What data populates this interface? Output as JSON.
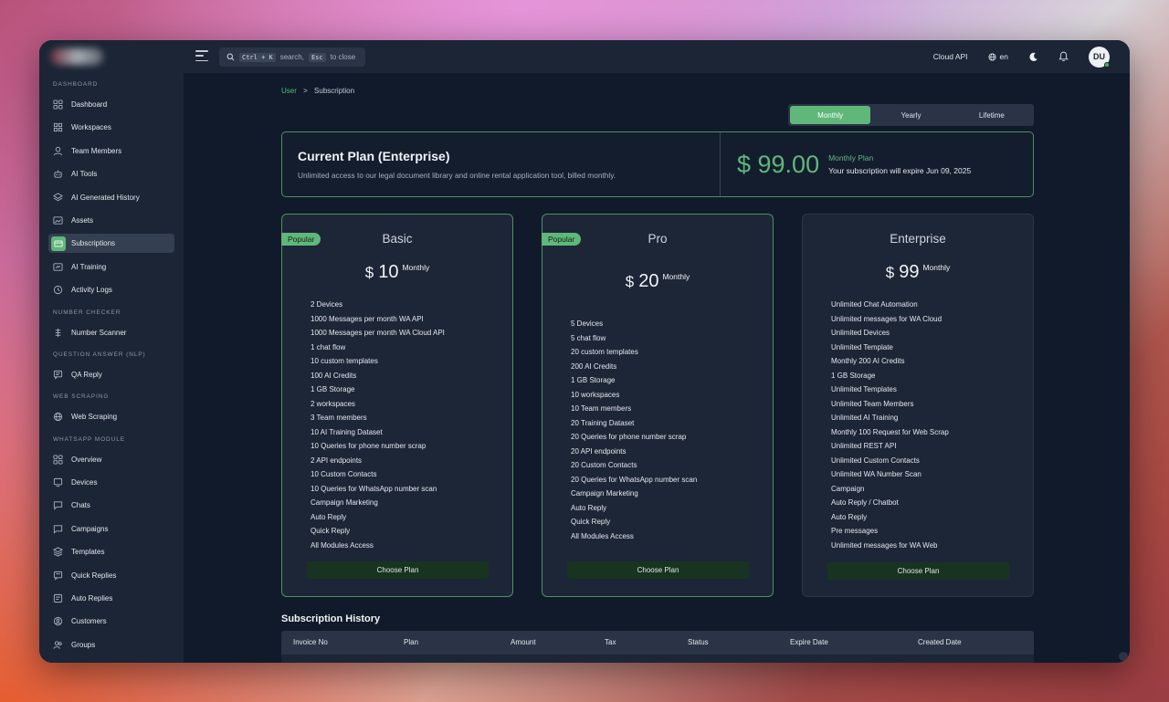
{
  "topbar": {
    "search": {
      "key1": "Ctrl + K",
      "text1": "search,",
      "key2": "Esc",
      "text2": "to close"
    },
    "cloud_api": "Cloud API",
    "language": "en",
    "avatar_initials": "DU"
  },
  "sidebar": {
    "sections": [
      {
        "title": "DASHBOARD",
        "items": [
          {
            "label": "Dashboard",
            "icon": "grid-icon"
          },
          {
            "label": "Workspaces",
            "icon": "workspace-icon"
          },
          {
            "label": "Team Members",
            "icon": "user-icon"
          },
          {
            "label": "AI Tools",
            "icon": "robot-icon"
          },
          {
            "label": "AI Generated History",
            "icon": "stack-icon"
          },
          {
            "label": "Assets",
            "icon": "image-icon"
          },
          {
            "label": "Subscriptions",
            "icon": "card-icon",
            "active": true
          },
          {
            "label": "AI Training",
            "icon": "training-icon"
          },
          {
            "label": "Activity Logs",
            "icon": "history-icon"
          }
        ]
      },
      {
        "title": "NUMBER CHECKER",
        "items": [
          {
            "label": "Number Scanner",
            "icon": "scanner-icon"
          }
        ]
      },
      {
        "title": "QUESTION ANSWER (NLP)",
        "items": [
          {
            "label": "QA Reply",
            "icon": "message-icon"
          }
        ]
      },
      {
        "title": "WEB SCRAPING",
        "items": [
          {
            "label": "Web Scraping",
            "icon": "globe-icon"
          }
        ]
      },
      {
        "title": "WHATSAPP MODULE",
        "items": [
          {
            "label": "Overview",
            "icon": "grid-icon"
          },
          {
            "label": "Devices",
            "icon": "device-icon"
          },
          {
            "label": "Chats",
            "icon": "chat-icon"
          },
          {
            "label": "Campaigns",
            "icon": "campaign-icon"
          },
          {
            "label": "Templates",
            "icon": "layers-icon"
          },
          {
            "label": "Quick Replies",
            "icon": "quick-reply-icon"
          },
          {
            "label": "Auto Replies",
            "icon": "auto-reply-icon"
          },
          {
            "label": "Customers",
            "icon": "customer-icon"
          },
          {
            "label": "Groups",
            "icon": "group-icon"
          }
        ]
      }
    ]
  },
  "breadcrumb": {
    "parent": "User",
    "separator": ">",
    "current": "Subscription"
  },
  "billing_toggle": {
    "options": [
      "Monthly",
      "Yearly",
      "Lifetime"
    ],
    "active": "Monthly"
  },
  "current_plan": {
    "title": "Current Plan (Enterprise)",
    "description": "Unlimited access to our legal document library and online rental application tool, billed monthly.",
    "price": "$ 99.00",
    "plan_name": "Monthly Plan",
    "expiry": "Your subscription will expire Jun 09, 2025"
  },
  "plans": [
    {
      "badge": "Popular",
      "name": "Basic",
      "currency": "$",
      "amount": "10",
      "period": "Monthly",
      "button": "Choose Plan",
      "features": [
        "2 Devices",
        "1000 Messages per month WA API",
        "1000 Messages per month WA Cloud API",
        "1 chat flow",
        "10 custom templates",
        "100 AI Credits",
        "1 GB Storage",
        "2 workspaces",
        "3 Team members",
        "10 AI Training Dataset",
        "10 Queries for phone number scrap",
        "2 API endpoints",
        "10 Custom Contacts",
        "10 Queries for WhatsApp number scan",
        "Campaign Marketing",
        "Auto Reply",
        "Quick Reply",
        "All Modules Access"
      ]
    },
    {
      "badge": "Popular",
      "name": "Pro",
      "currency": "$",
      "amount": "20",
      "period": "Monthly",
      "button": "Choose Plan",
      "features": [
        "5 Devices",
        "5 chat flow",
        "20 custom templates",
        "200 AI Credits",
        "1 GB Storage",
        "10 workspaces",
        "10 Team members",
        "20 Training Dataset",
        "20 Queries for phone number scrap",
        "20 API endpoints",
        "20 Custom Contacts",
        "20 Queries for WhatsApp number scan",
        "Campaign Marketing",
        "Auto Reply",
        "Quick Reply",
        "All Modules Access"
      ]
    },
    {
      "badge": "",
      "name": "Enterprise",
      "currency": "$",
      "amount": "99",
      "period": "Monthly",
      "button": "Choose Plan",
      "features": [
        "Unlimited Chat Automation",
        "Unlimited messages for WA Cloud",
        "Unlimited Devices",
        "Unlimited Template",
        "Monthly 200 AI Credits",
        "1 GB Storage",
        "Unlimited Templates",
        "Unlimited Team Members",
        "Unlimited AI Training",
        "Monthly 100 Request for Web Scrap",
        "Unlimited REST API",
        "Unlimited Custom Contacts",
        "Unlimited WA Number Scan",
        "Campaign",
        "Auto Reply / Chatbot",
        "Auto Reply",
        "Pre messages",
        "Unlimited messages for WA Web"
      ]
    }
  ],
  "history": {
    "title": "Subscription History",
    "columns": [
      "Invoice No",
      "Plan",
      "Amount",
      "Tax",
      "Status",
      "Expire Date",
      "Created Date"
    ]
  },
  "colors": {
    "accent": "#5fb77a",
    "background": "#111a2b",
    "panel": "#1b2535",
    "card": "#1d2637"
  }
}
